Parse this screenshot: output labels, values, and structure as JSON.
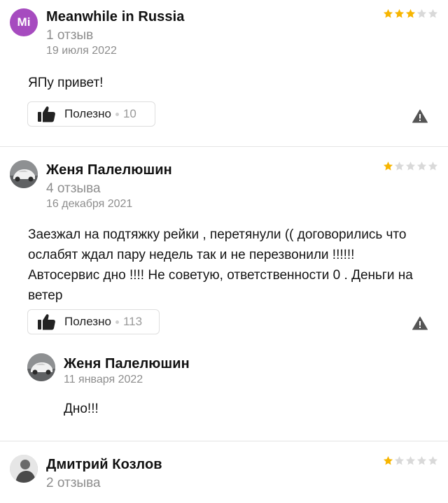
{
  "reviews": [
    {
      "author": "Meanwhile in Russia",
      "initials": "Mi",
      "reviews_count": "1 отзыв",
      "date": "19 июля 2022",
      "rating": 3,
      "text": "ЯПу привет!",
      "useful_label": "Полезно",
      "useful_count": "10"
    },
    {
      "author": "Женя Палелюшин",
      "reviews_count": "4 отзыва",
      "date": "16 декабря 2021",
      "rating": 1,
      "text": "Заезжал на подтяжку рейки , перетянули (( договорились что ослабят ждал пару недель так и не перезвонили !!!!!! Автосервис дно !!!! Не советую, ответственности 0 . Деньги на ветер",
      "useful_label": "Полезно",
      "useful_count": "113",
      "reply": {
        "author": "Женя Палелюшин",
        "date": "11 января 2022",
        "text": "Дно!!!"
      }
    },
    {
      "author": "Дмитрий Козлов",
      "reviews_count": "2 отзыва",
      "rating": 1
    }
  ],
  "colors": {
    "star_filled": "#f7b500",
    "star_empty": "#d9d9d9",
    "initials_avatar": "#a64bbf"
  },
  "icons": {
    "useful": "thumbs-up-icon",
    "report": "warning-triangle-icon"
  }
}
